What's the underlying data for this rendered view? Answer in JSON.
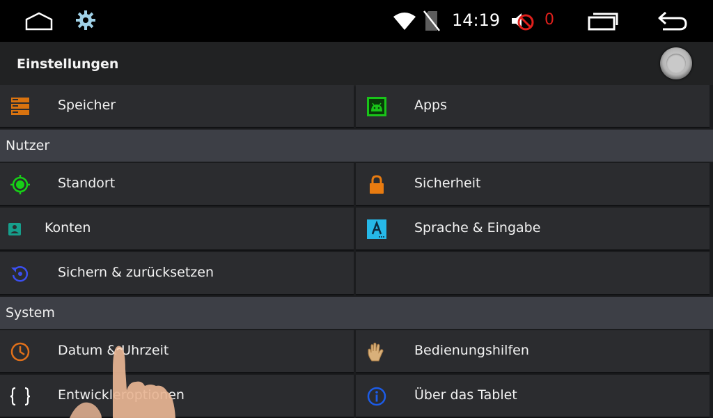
{
  "status_bar": {
    "time": "14:19",
    "notification_count": "0",
    "icons": [
      "home-outline-icon",
      "gear-icon",
      "wifi-icon",
      "no-sim-icon",
      "volume-muted-icon",
      "recent-apps-icon",
      "back-arrow-icon"
    ]
  },
  "header": {
    "title": "Einstellungen"
  },
  "sections": [
    {
      "title": "",
      "items": [
        {
          "label": "Speicher",
          "icon": "storage-icon"
        },
        {
          "label": "Apps",
          "icon": "android-apps-icon"
        }
      ]
    },
    {
      "title": "Nutzer",
      "items": [
        {
          "label": "Standort",
          "icon": "location-icon"
        },
        {
          "label": "Sicherheit",
          "icon": "lock-icon"
        },
        {
          "label": "Konten",
          "icon": "account-icon"
        },
        {
          "label": "Sprache & Eingabe",
          "icon": "language-icon"
        },
        {
          "label": "Sichern & zurücksetzen",
          "icon": "backup-reset-icon"
        }
      ]
    },
    {
      "title": "System",
      "items": [
        {
          "label": "Datum & Uhrzeit",
          "icon": "clock-icon"
        },
        {
          "label": "Bedienungshilfen",
          "icon": "hand-icon"
        },
        {
          "label": "Entwickleroptionen",
          "icon": "braces-icon"
        },
        {
          "label": "Über das Tablet",
          "icon": "info-icon"
        }
      ]
    }
  ],
  "colors": {
    "status_bar": "#000000",
    "title_bar": "#212223",
    "section_header": "#3d3f46",
    "cell": "#2b2c2f",
    "accent_red": "#e0201c",
    "storage_orange": "#d9730f",
    "apps_green": "#19c419",
    "location_green": "#17d017",
    "lock_orange": "#e87b10",
    "account_teal": "#169f8c",
    "language_cyan": "#26b8e8",
    "backup_blue": "#3b4ff0",
    "clock_orange": "#e0701a",
    "info_blue": "#1c5ce8"
  }
}
